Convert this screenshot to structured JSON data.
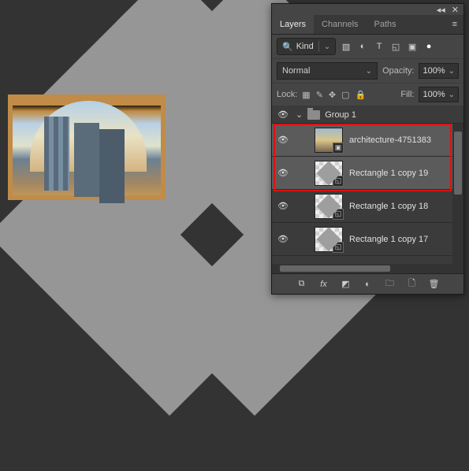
{
  "panel": {
    "tabs": [
      "Layers",
      "Channels",
      "Paths"
    ],
    "activeTab": 0,
    "filter": {
      "icon": "🔍",
      "label": "Kind"
    },
    "blend": {
      "mode": "Normal",
      "opacityLabel": "Opacity:",
      "opacityValue": "100%"
    },
    "lock": {
      "label": "Lock:",
      "fillLabel": "Fill:",
      "fillValue": "100%"
    },
    "group": {
      "name": "Group 1"
    },
    "layers": [
      {
        "name": "architecture-4751383",
        "type": "photo",
        "selected": true
      },
      {
        "name": "Rectangle 1 copy 19",
        "type": "shape",
        "selected": true
      },
      {
        "name": "Rectangle 1 copy 18",
        "type": "shape",
        "selected": false
      },
      {
        "name": "Rectangle 1 copy 17",
        "type": "shape",
        "selected": false
      }
    ]
  }
}
